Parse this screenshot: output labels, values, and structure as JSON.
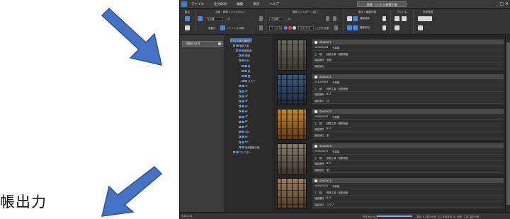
{
  "caption": "帳出力",
  "titlebar": {
    "menu": [
      "ファイル",
      "仕分BOX",
      "編集",
      "表示",
      "ヘルプ"
    ],
    "doc_title": "現場：○○ビル新築工事",
    "controls": "_ □ ✕"
  },
  "ribbon": {
    "groups": [
      "取込",
      "台帳・登録ファイルボルト",
      "検索フィルター・並び",
      "表示・編集切替",
      "アルバム",
      "外部連携"
    ],
    "kind_field_label": "写真種",
    "kind_field_placeholder": "工種",
    "date_label": "撮影日",
    "file_label": "(ファイル日時)",
    "filter_kind": "写真種",
    "filter_kind_value": "工種",
    "filter_label": "フィルタ",
    "filter_value": "並び方法",
    "sort_value": "上下左右順",
    "display_a": "撮影箇所",
    "display_b": "撮影部位"
  },
  "leftpane": {
    "date_chip": "日数付/日付"
  },
  "tree": [
    {
      "label": "工種・種別工",
      "selected": true
    },
    {
      "label": "躯体工事"
    },
    {
      "label": "配筋検査"
    },
    {
      "label": "基礎"
    },
    {
      "label": "B1F"
    },
    {
      "label": "柱"
    },
    {
      "label": "梁"
    },
    {
      "label": "壁"
    },
    {
      "label": "スラブ"
    },
    {
      "label": "1F"
    },
    {
      "label": "2F"
    },
    {
      "label": "3F"
    },
    {
      "label": "4F"
    },
    {
      "label": "5F"
    },
    {
      "label": "6F"
    },
    {
      "label": "7F"
    },
    {
      "label": "8F"
    },
    {
      "label": "9F"
    },
    {
      "label": "10F"
    },
    {
      "label": "RF"
    },
    {
      "label": "PH"
    },
    {
      "label": "仮設建築の他"
    },
    {
      "label": "ブリスター"
    }
  ],
  "photos": [
    {
      "number": "0000021",
      "date": "2009/01/04",
      "kind": "写真種",
      "work": "工　種",
      "work_value": "鉄筋工事・配筋検査",
      "place_label": "撮影箇所",
      "place": "基礎",
      "part_label": "撮影部位",
      "part": ""
    },
    {
      "number": "0000021",
      "date": "2010/08/05",
      "kind": "写真種",
      "work": "工　種",
      "work_value": "鉄筋工事・配筋検査",
      "place_label": "撮影箇所",
      "place": "B1F",
      "part_label": "撮影部位",
      "part": "柱"
    },
    {
      "number": "0000023",
      "date": "1999/04/27",
      "kind": "写真種",
      "work": "工　種",
      "work_value": "鉄筋工事・配筋検査",
      "place_label": "撮影箇所",
      "place": "B1F",
      "part_label": "撮影部位",
      "part": "梁"
    },
    {
      "number": "0000024",
      "date": "1999/04/27",
      "kind": "写真種",
      "work": "工　種",
      "work_value": "鉄筋工事・配筋検査",
      "place_label": "撮影箇所",
      "place": "B1F",
      "part_label": "撮影部位",
      "part": "壁"
    },
    {
      "number": "0000025",
      "date": "1999/04/27",
      "kind": "写真種",
      "work": "工　種",
      "work_value": "鉄筋工事・配筋検査",
      "place_label": "撮影箇所",
      "place": "B1F",
      "part_label": "撮影部位",
      "part": "スラブ"
    }
  ],
  "statusbar": {
    "left": "写真 (20)",
    "zoom_label": "写真(Normal)",
    "right": "選択: 0 | 表示写真: 20 | 外部写真: 0 | 削除: 工事: 撮影日時"
  },
  "colors": {
    "arrow": "#4472c4",
    "accent": "#4a88d8"
  }
}
